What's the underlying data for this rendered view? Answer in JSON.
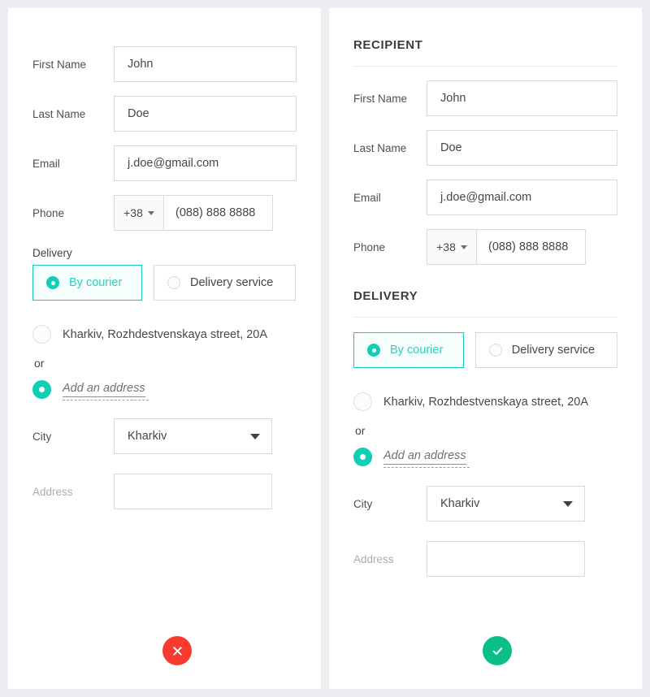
{
  "theme": {
    "page_background": "#eceef1",
    "panel_background": "#ffffff",
    "accent_teal": "#0fcfb4",
    "accent_teal_border": "#17c9b5",
    "accent_teal_text": "#2fd0bb",
    "cancel_red": "#f93a2f",
    "confirm_green": "#0bc088",
    "border_grey": "#d8dade",
    "label_grey": "#4c5055",
    "placeholder_grey": "#a9adb2"
  },
  "left_panel": {
    "name": "form-variant-without-headings",
    "fields": {
      "first_name": {
        "label": "First Name",
        "value": "John"
      },
      "last_name": {
        "label": "Last Name",
        "value": "Doe"
      },
      "email": {
        "label": "Email",
        "value": "j.doe@gmail.com"
      },
      "phone": {
        "label": "Phone",
        "country_code": "+38",
        "value": "(088) 888 8888"
      }
    },
    "delivery": {
      "inline_label": "Delivery",
      "options": [
        {
          "label": "By courier",
          "selected": true
        },
        {
          "label": "Delivery service",
          "selected": false
        }
      ],
      "saved_address": {
        "label": "Kharkiv, Rozhdestvenskaya street, 20A",
        "selected": false
      },
      "or_label": "or",
      "add_address": {
        "label": "Add an address",
        "selected": true
      },
      "city": {
        "label": "City",
        "value": "Kharkiv"
      },
      "address": {
        "label": "Address",
        "value": ""
      }
    },
    "actions": {
      "button": {
        "icon": "close-icon",
        "glyph": "✕",
        "color": "#f93a2f"
      }
    }
  },
  "right_panel": {
    "name": "form-variant-with-headings",
    "headings": {
      "recipient": "RECIPIENT",
      "delivery": "DELIVERY"
    },
    "fields": {
      "first_name": {
        "label": "First Name",
        "value": "John"
      },
      "last_name": {
        "label": "Last Name",
        "value": "Doe"
      },
      "email": {
        "label": "Email",
        "value": "j.doe@gmail.com"
      },
      "phone": {
        "label": "Phone",
        "country_code": "+38",
        "value": "(088) 888 8888"
      }
    },
    "delivery": {
      "options": [
        {
          "label": "By courier",
          "selected": true
        },
        {
          "label": "Delivery service",
          "selected": false
        }
      ],
      "saved_address": {
        "label": "Kharkiv, Rozhdestvenskaya street, 20A",
        "selected": false
      },
      "or_label": "or",
      "add_address": {
        "label": "Add an address",
        "selected": true
      },
      "city": {
        "label": "City",
        "value": "Kharkiv"
      },
      "address": {
        "label": "Address",
        "value": ""
      }
    },
    "actions": {
      "button": {
        "icon": "check-icon",
        "glyph": "✓",
        "color": "#0bc088"
      }
    }
  }
}
